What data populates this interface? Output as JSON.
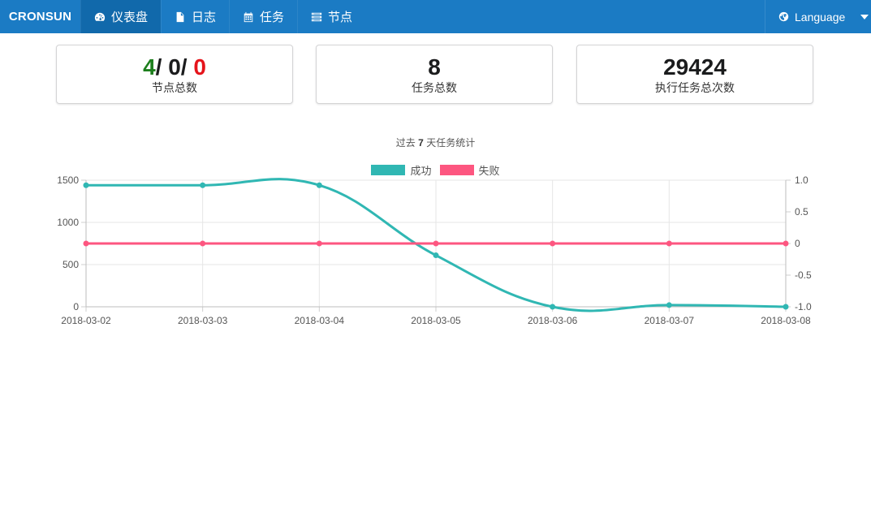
{
  "header": {
    "brand": "CRONSUN",
    "nav": [
      {
        "label": "仪表盘",
        "icon": "dashboard-icon",
        "active": true
      },
      {
        "label": "日志",
        "icon": "document-icon",
        "active": false
      },
      {
        "label": "任务",
        "icon": "calendar-icon",
        "active": false
      },
      {
        "label": "节点",
        "icon": "server-icon",
        "active": false
      }
    ],
    "language": {
      "label": "Language",
      "icon": "globe-icon"
    }
  },
  "stats": {
    "nodes": {
      "online": "4",
      "sep1": "/ ",
      "offline": "0",
      "sep2": "/ ",
      "damaged": "0",
      "label": "节点总数"
    },
    "jobs": {
      "value": "8",
      "label": "任务总数"
    },
    "executions": {
      "value": "29424",
      "label": "执行任务总次数"
    }
  },
  "colors": {
    "success": "#30b7b3",
    "fail": "#fd5680",
    "header_bg": "#1b7bc4"
  },
  "chart_data": {
    "type": "line",
    "title_prefix": "过去",
    "title_number": "7",
    "title_suffix": "天任务统计",
    "categories": [
      "2018-03-02",
      "2018-03-03",
      "2018-03-04",
      "2018-03-05",
      "2018-03-06",
      "2018-03-07",
      "2018-03-08"
    ],
    "series": [
      {
        "name": "成功",
        "axis": "left",
        "color": "#30b7b3",
        "values": [
          1440,
          1440,
          1440,
          610,
          0,
          20,
          0
        ]
      },
      {
        "name": "失败",
        "axis": "right",
        "color": "#fd5680",
        "values": [
          0,
          0,
          0,
          0,
          0,
          0,
          0
        ]
      }
    ],
    "y_left": {
      "ylim": [
        0,
        1500
      ],
      "ticks": [
        "1500",
        "1000",
        "500",
        "0"
      ]
    },
    "y_right": {
      "ylim": [
        -1,
        1
      ],
      "ticks": [
        "1.0",
        "0.5",
        "0",
        "-0.5",
        "-1.0"
      ]
    },
    "grid": true,
    "legend_position": "top-center"
  }
}
